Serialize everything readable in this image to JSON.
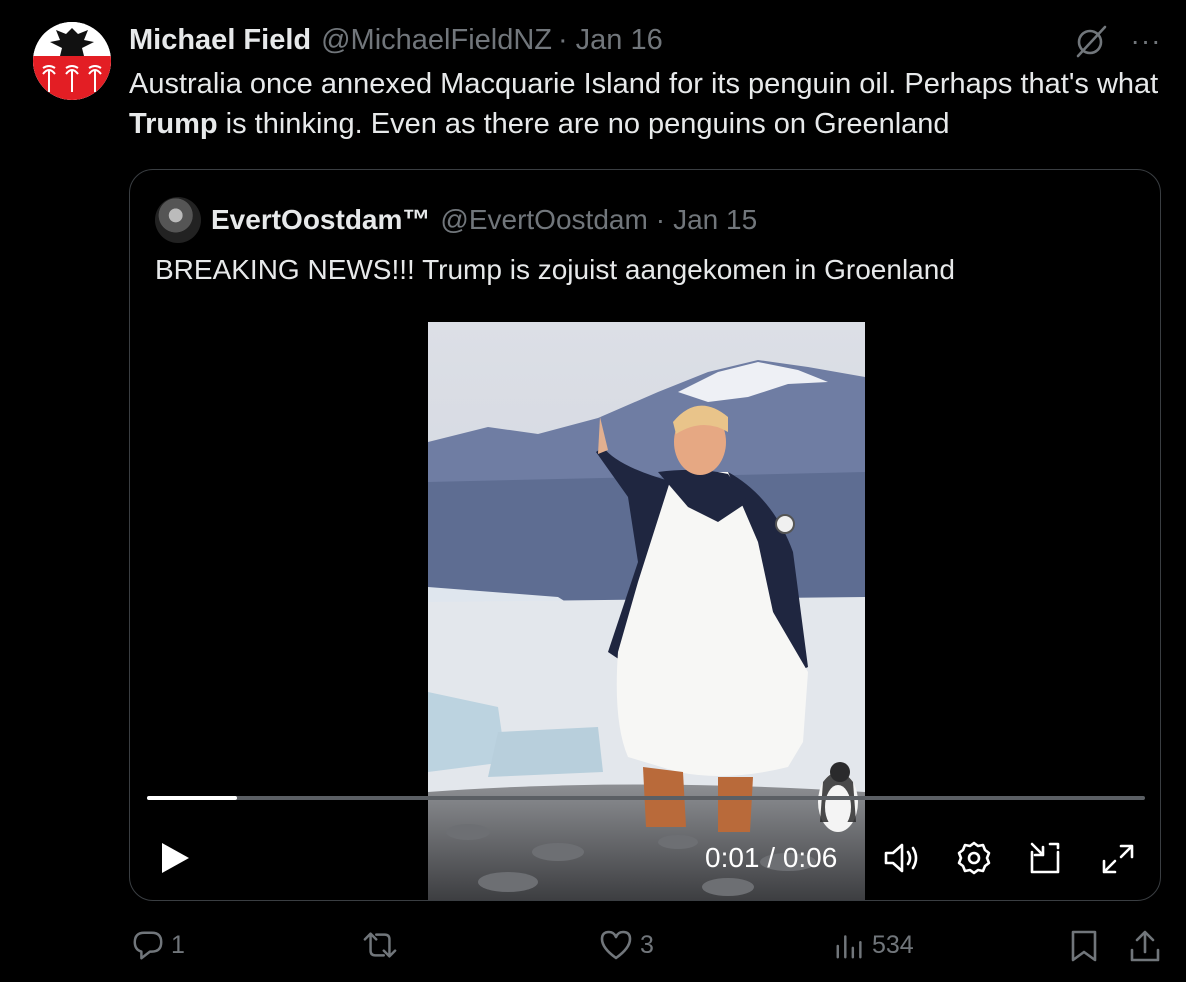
{
  "tweet": {
    "author_name": "Michael Field",
    "author_handle": "@MichaelFieldNZ",
    "separator": "·",
    "date": "Jan 16",
    "more_label": "···",
    "text_before": "Australia once annexed Macquarie Island for its penguin oil. Perhaps that's what ",
    "text_bold": "Trump",
    "text_after": " is thinking. Even as there are no penguins on Greenland"
  },
  "quoted": {
    "author_name": "EvertOostdam™",
    "author_handle": "@EvertOostdam",
    "separator": "·",
    "date": "Jan 15",
    "text": "BREAKING NEWS!!! Trump is zojuist aangekomen in Groenland"
  },
  "video": {
    "time_display": "0:01 / 0:06",
    "progress_fraction": 0.09
  },
  "actions": {
    "replies": "1",
    "reposts": "",
    "likes": "3",
    "views": "534"
  },
  "colors": {
    "background": "#000000",
    "text": "#e7e9ea",
    "muted": "#71767b",
    "border": "#3a3e42",
    "avatar_red": "#e31e24"
  },
  "icons": [
    "grok-icon",
    "more-icon",
    "play-icon",
    "volume-icon",
    "gear-icon",
    "pip-icon",
    "expand-icon",
    "reply-icon",
    "repost-icon",
    "like-icon",
    "views-icon",
    "bookmark-icon",
    "share-icon"
  ]
}
